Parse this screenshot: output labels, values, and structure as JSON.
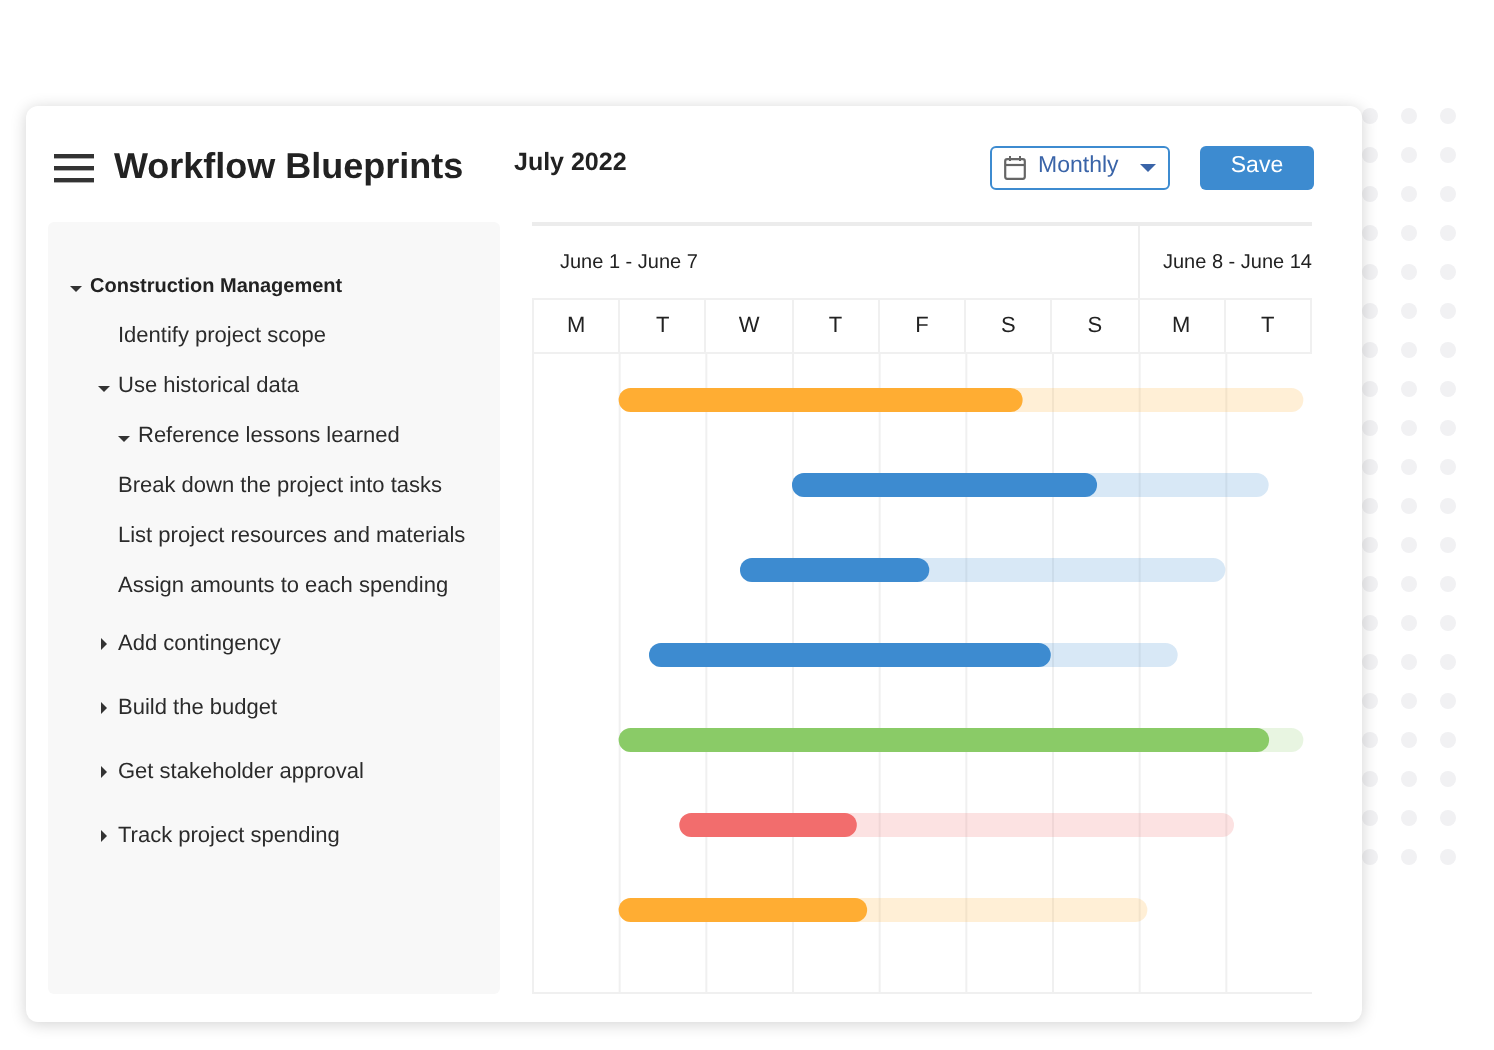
{
  "header": {
    "title": "Workflow Blueprints",
    "period": "July 2022",
    "view_select": {
      "value": "Monthly"
    },
    "save_button": "Save"
  },
  "tree": [
    {
      "label": "Construction Management",
      "expanded": true,
      "children": [
        {
          "label": "Identify project scope"
        },
        {
          "label": "Use historical data",
          "expanded": true,
          "children": [
            {
              "label": "Reference lessons learned",
              "expanded": true
            }
          ]
        },
        {
          "label": "Break down the project into tasks"
        },
        {
          "label": "List project resources and materials"
        },
        {
          "label": "Assign amounts to each spending"
        },
        {
          "label": "Add contingency",
          "expanded": false
        },
        {
          "label": "Build the budget",
          "expanded": false
        },
        {
          "label": "Get stakeholder approval",
          "expanded": false
        },
        {
          "label": "Track project spending",
          "expanded": false
        }
      ]
    }
  ],
  "gantt": {
    "weeks": [
      {
        "label": "June 1 - June 7",
        "days": [
          "M",
          "T",
          "W",
          "T",
          "F",
          "S",
          "S"
        ]
      },
      {
        "label": "June 8 - June 14",
        "days": [
          "M",
          "T"
        ]
      }
    ],
    "tasks": [
      {
        "color": "#ffad33",
        "level": 0.59
      },
      {
        "color": "#3d8bd0",
        "level": 0.64
      },
      {
        "color": "#3d8bd0",
        "level": 0.39
      },
      {
        "color": "#3d8bd0",
        "level": 0.76
      },
      {
        "color": "#8acb67",
        "level": 0.95
      },
      {
        "color": "#f26d6d",
        "level": 0.32
      },
      {
        "color": "#ffad33",
        "level": 0.47
      }
    ]
  }
}
